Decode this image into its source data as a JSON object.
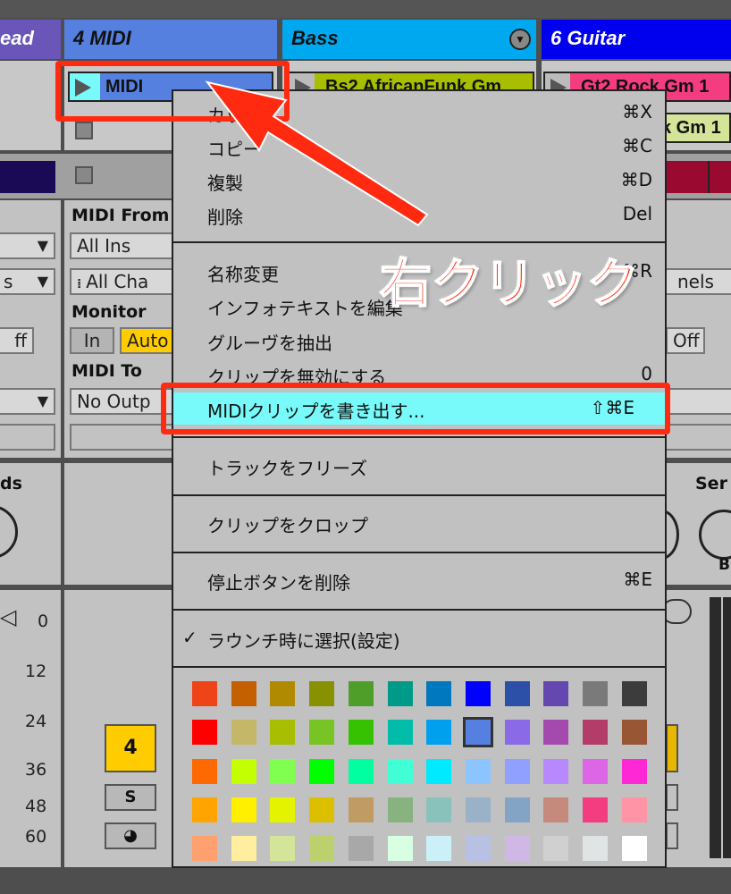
{
  "tracks": [
    {
      "name": "ead",
      "color": "#6a55b8"
    },
    {
      "name": "4 MIDI",
      "color": "#5580e0"
    },
    {
      "name": "Bass",
      "color": "#00a8f0"
    },
    {
      "name": "6 Guitar",
      "color": "#0000ee"
    }
  ],
  "clips": {
    "midi": "MIDI",
    "bass": "Bs2 AfricanFunk Gm",
    "guitar1": "Gt2 Rock Gm 1",
    "guitar2": "k Gm 1"
  },
  "io": {
    "midi_from_label": "MIDI From",
    "midi_from_value": "All Ins",
    "channel_value": "All Cha",
    "monitor_label": "Monitor",
    "monitor_in": "In",
    "monitor_auto": "Auto",
    "midi_to_label": "MIDI To",
    "midi_to_value": "No Outp",
    "left_channel_partial": "s",
    "left_off_partial": "ff",
    "right_channels_partial": "nels",
    "right_off": "Off"
  },
  "sends": {
    "left_label": "ds",
    "right_label": "Ser",
    "right_knob_letter": "B"
  },
  "meter_ticks": [
    "0",
    "12",
    "24",
    "36",
    "48",
    "60"
  ],
  "mixer": {
    "track_number": "4",
    "solo": "S"
  },
  "context_menu": {
    "items": [
      {
        "label": "カット",
        "shortcut": "⌘X"
      },
      {
        "label": "コピー",
        "shortcut": "⌘C"
      },
      {
        "label": "複製",
        "shortcut": "⌘D"
      },
      {
        "label": "削除",
        "shortcut": "Del"
      },
      {
        "label": "名称変更",
        "shortcut": "⌘R"
      },
      {
        "label": "インフォテキストを編集",
        "shortcut": ""
      },
      {
        "label": "グルーヴを抽出",
        "shortcut": ""
      },
      {
        "label": "クリップを無効にする",
        "shortcut": "0"
      },
      {
        "label": "MIDIクリップを書き出す...",
        "shortcut": "⇧⌘E",
        "highlighted": true
      },
      {
        "label": "トラックをフリーズ",
        "shortcut": ""
      },
      {
        "label": "クリップをクロップ",
        "shortcut": ""
      },
      {
        "label": "停止ボタンを削除",
        "shortcut": "⌘E"
      },
      {
        "label": "ラウンチ時に選択(設定)",
        "shortcut": "",
        "checked": true
      }
    ],
    "highlight_color": "#78fafa",
    "palette": [
      [
        "#ee4418",
        "#c46000",
        "#b08a00",
        "#889200",
        "#509e2a",
        "#009a88",
        "#0078c0",
        "#0000ff",
        "#2c50a8",
        "#6448b0",
        "#7a7a7a",
        "#3c3c3c"
      ],
      [
        "#ff0000",
        "#c4b868",
        "#a8be00",
        "#78c424",
        "#36c200",
        "#00bca8",
        "#00a0ee",
        "#5580e0",
        "#8a6ae6",
        "#a44aae",
        "#b43c68",
        "#985634"
      ],
      [
        "#ff6a00",
        "#c4ff00",
        "#80ff50",
        "#00ff00",
        "#00ffa0",
        "#40ffd4",
        "#00eaff",
        "#8cc4ff",
        "#90a0ff",
        "#b888ff",
        "#dc66e6",
        "#ff28d4"
      ],
      [
        "#ffa400",
        "#fff000",
        "#e4f400",
        "#dcc000",
        "#c09c64",
        "#88b27e",
        "#88c2ba",
        "#9ab2c8",
        "#84a4c6",
        "#c68a7c",
        "#f43c80",
        "#ff94a6"
      ],
      [
        "#ffa070",
        "#ffeea0",
        "#d4e498",
        "#bcd06e",
        "#a8a8a8",
        "#d8ffe2",
        "#ccf0f8",
        "#b8c0e4",
        "#d0b8e6",
        "#d0d0d0",
        "#e0e4e4",
        "#ffffff"
      ]
    ],
    "selected_color": "#5580e0"
  },
  "annotation": {
    "text": "右クリック",
    "color": "#ff2a10"
  }
}
